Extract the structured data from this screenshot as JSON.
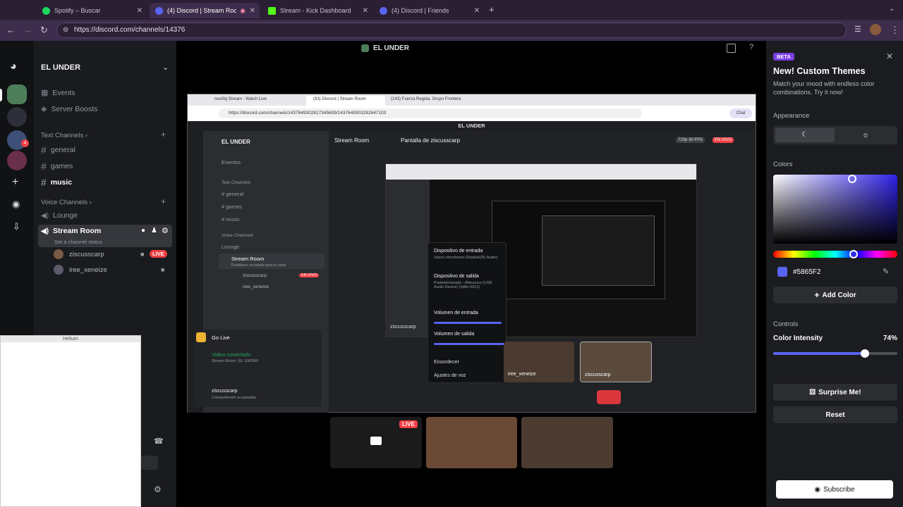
{
  "browser": {
    "tabs": [
      {
        "title": "Spotify – Buscar",
        "color": "#1ed760"
      },
      {
        "title": "(4) Discord | Stream Room",
        "color": "#5865f2"
      },
      {
        "title": "Stream - Kick Dashboard",
        "color": "#53fc18"
      },
      {
        "title": "(4) Discord | Friends",
        "color": "#5865f2"
      }
    ],
    "url": "https://discord.com/channels/14376"
  },
  "header": {
    "title": "EL UNDER"
  },
  "server": {
    "name": "EL UNDER",
    "events": "Events",
    "boosts": "Server Boosts",
    "text_category": "Text Channels",
    "text_channels": [
      "general",
      "games",
      "music"
    ],
    "voice_category": "Voice Channels",
    "voice_channels": [
      "Lounge",
      "Stream Room"
    ],
    "status_placeholder": "Set a channel status",
    "members": [
      {
        "name": "ziscusscarp",
        "badge": "LIVE"
      },
      {
        "name": "iree_xeneize",
        "badge": ""
      }
    ]
  },
  "helium": {
    "title": "Helium"
  },
  "inner": {
    "tabs": [
      "neo0bj Stream - Watch Live",
      "(93) Discord | Stream Room",
      "(143) Fuerza Regida, Grupo Frontera"
    ],
    "url": "https://discord.com/channels/1437649302817345609/1437649303282647103",
    "header": "EL UNDER",
    "server": "EL UNDER",
    "channel": "Stream Room",
    "screen_title": "Pantalla de ziscusscarp",
    "quality": "720p 30 FPS",
    "live": "EN VIVO",
    "events": "Eventos",
    "text_category": "Text Channels",
    "text_channels": [
      "general",
      "games",
      "music"
    ],
    "voice_category": "Voice Channels",
    "voice_channels": [
      "Lounge",
      "Stream Room"
    ],
    "status": "Establecer un estado para el canal",
    "members": [
      "ziscusscarp",
      "iree_xeneize"
    ],
    "golive": "Go Live",
    "video_connected": "Video conectado",
    "video_sub": "Stream Room / EL UNDER",
    "user": "ziscusscarp",
    "user_status": "Compartiendo su pantalla",
    "menu": {
      "input_label": "Dispositivo de entrada",
      "input_value": "Varios micrófonos (Realtek(R) Audio)",
      "output_label": "Dispositivo de salida",
      "output_value": "Predeterminado - Altavoces (USB Audio Device) (0d8c:0012)",
      "input_volume": "Volumen de entrada",
      "output_volume": "Volumen de salida",
      "deafen": "Ensordecer",
      "voice_settings": "Ajustes de voz"
    },
    "tile_names": [
      "iree_xeneize",
      "ziscusscarp"
    ],
    "tiny_share_label": "ziscusscarp"
  },
  "bottom_live": "LIVE",
  "panel": {
    "beta": "BETA",
    "title": "New! Custom Themes",
    "subtitle": "Match your mood with endless color combinations. Try it now!",
    "appearance": "Appearance",
    "colors": "Colors",
    "hex": "#5865F2",
    "add_color": "Add Color",
    "controls": "Controls",
    "intensity_label": "Color Intensity",
    "intensity_value": "74%",
    "intensity_fraction": 0.74,
    "surprise": "Surprise Me!",
    "reset": "Reset",
    "subscribe": "Subscribe",
    "accent": "#5865F2"
  }
}
